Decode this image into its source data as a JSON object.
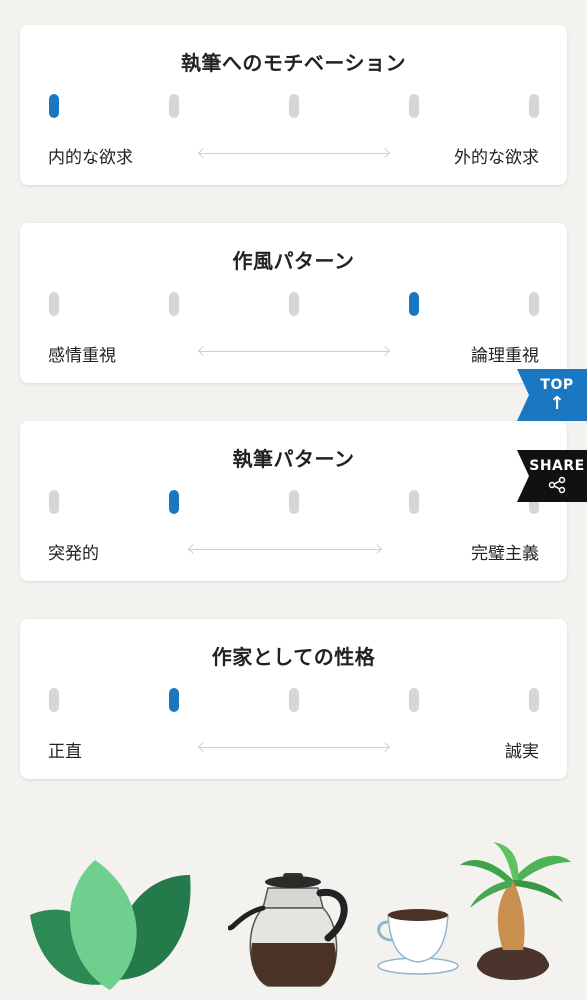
{
  "cards": [
    {
      "title": "執筆へのモチベーション",
      "left": "内的な欲求",
      "right": "外的な欲求",
      "selected": 0
    },
    {
      "title": "作風パターン",
      "left": "感情重視",
      "right": "論理重視",
      "selected": 3
    },
    {
      "title": "執筆パターン",
      "left": "突発的",
      "right": "完璧主義",
      "selected": 1
    },
    {
      "title": "作家としての性格",
      "left": "正直",
      "right": "誠実",
      "selected": 1
    }
  ],
  "scale_steps": 5,
  "side_buttons": {
    "top_label": "TOP",
    "top_icon": "arrow-up-icon",
    "share_label": "SHARE",
    "share_icon": "share-icon"
  },
  "colors": {
    "accent": "#1a78c2",
    "inactive_dot": "#d6d6d6",
    "share_bg": "#111111",
    "background": "#f3f2ef"
  },
  "decorations": [
    "leaves-icon",
    "coffee-pot-icon",
    "coffee-cup-icon",
    "palm-plant-icon"
  ]
}
